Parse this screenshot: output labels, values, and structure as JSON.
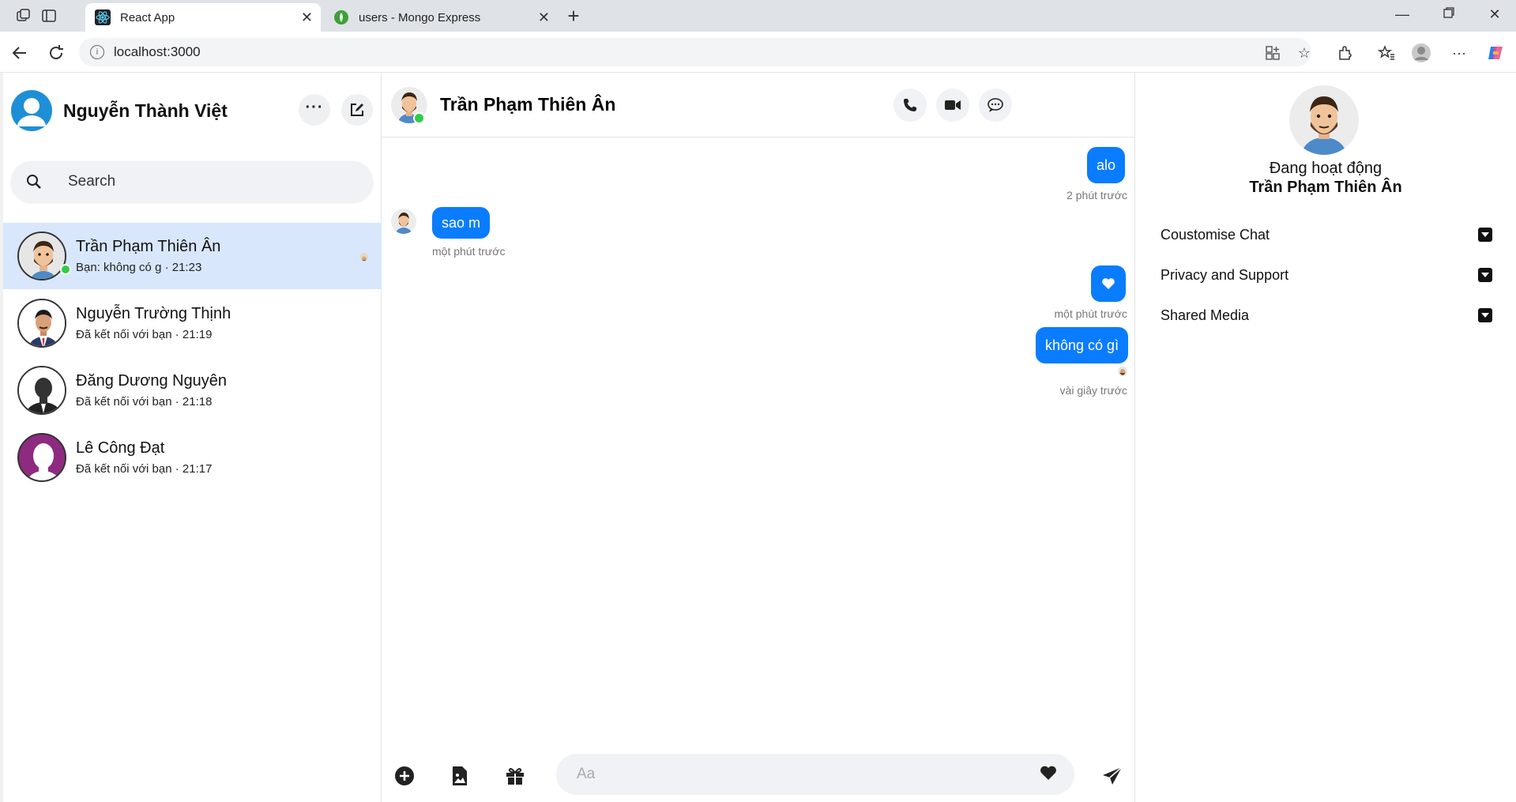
{
  "browser": {
    "tabs": [
      {
        "title": "React App",
        "active": true
      },
      {
        "title": "users - Mongo Express",
        "active": false
      }
    ],
    "url": "localhost:3000"
  },
  "sidebar": {
    "user_name": "Nguyễn Thành Việt",
    "search_placeholder": "Search",
    "conversations": [
      {
        "name": "Trần Phạm Thiên Ân",
        "last": "Bạn: không có g · 21:23",
        "active": true,
        "online": true
      },
      {
        "name": "Nguyễn Trường Thịnh",
        "last": "Đã kết nối với bạn · 21:19",
        "active": false
      },
      {
        "name": "Đăng Dương Nguyên",
        "last": "Đã kết nối với bạn · 21:18",
        "active": false
      },
      {
        "name": "Lê Công Đạt",
        "last": "Đã kết nối với bạn · 21:17",
        "active": false
      }
    ]
  },
  "chat": {
    "peer_name": "Trần Phạm Thiên Ân",
    "messages": [
      {
        "text": "alo",
        "from": "me",
        "time": "2 phút trước"
      },
      {
        "text": "sao m",
        "from": "peer",
        "time": "một phút trước"
      },
      {
        "text": "heart",
        "from": "me",
        "time": "một phút trước"
      },
      {
        "text": "không có gì",
        "from": "me",
        "time": "vài giây trước"
      }
    ],
    "composer_placeholder": "Aa"
  },
  "info": {
    "status": "Đang hoạt động",
    "name": "Trần Phạm Thiên Ân",
    "sections": [
      "Coustomise Chat",
      "Privacy and Support",
      "Shared Media"
    ]
  },
  "colors": {
    "accent": "#0a7cff",
    "online": "#31cc46",
    "active_row": "#d8e7fb"
  }
}
